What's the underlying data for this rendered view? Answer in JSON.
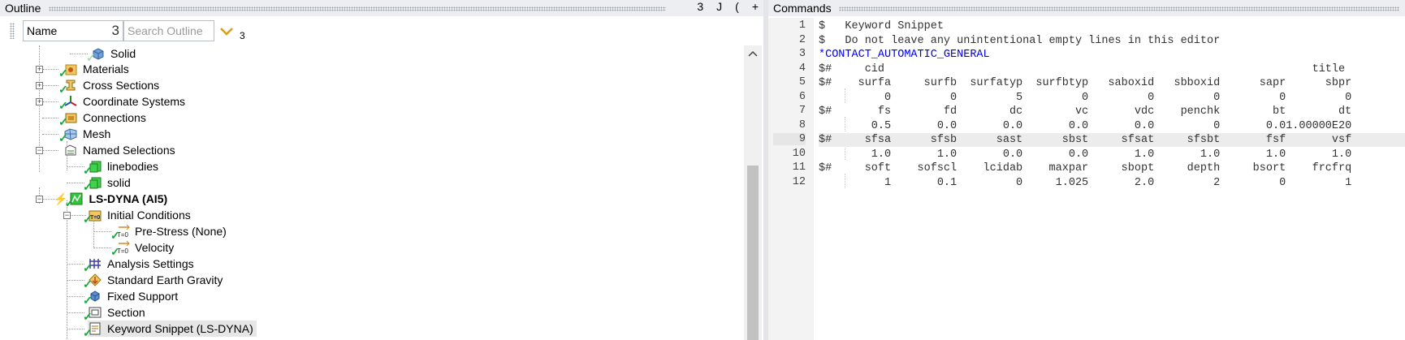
{
  "outline": {
    "title": "Outline",
    "actions": [
      "3",
      "J",
      "(",
      "+"
    ],
    "name_field": {
      "value": "Name",
      "count": "3"
    },
    "search": {
      "placeholder": "Search Outline"
    },
    "filter_count": "3",
    "tree": [
      {
        "label": "Solid",
        "icon": "solid-body-icon"
      },
      {
        "label": "Materials",
        "icon": "materials-icon"
      },
      {
        "label": "Cross Sections",
        "icon": "cross-sections-icon"
      },
      {
        "label": "Coordinate Systems",
        "icon": "coordinate-systems-icon"
      },
      {
        "label": "Connections",
        "icon": "connections-icon"
      },
      {
        "label": "Mesh",
        "icon": "mesh-icon"
      },
      {
        "label": "Named Selections",
        "icon": "named-selections-icon"
      },
      {
        "label": "linebodies",
        "icon": "named-selection-item-icon"
      },
      {
        "label": "solid",
        "icon": "named-selection-item-icon"
      },
      {
        "label": "LS-DYNA (AI5)",
        "icon": "ls-dyna-icon"
      },
      {
        "label": "Initial Conditions",
        "icon": "initial-conditions-icon"
      },
      {
        "label": "Pre-Stress (None)",
        "icon": "pre-stress-icon"
      },
      {
        "label": "Velocity",
        "icon": "velocity-icon"
      },
      {
        "label": "Analysis Settings",
        "icon": "analysis-settings-icon"
      },
      {
        "label": "Standard Earth Gravity",
        "icon": "gravity-icon"
      },
      {
        "label": "Fixed Support",
        "icon": "fixed-support-icon"
      },
      {
        "label": "Section",
        "icon": "section-icon"
      },
      {
        "label": "Keyword Snippet (LS-DYNA)",
        "icon": "keyword-snippet-icon"
      }
    ]
  },
  "commands": {
    "title": "Commands",
    "lines": [
      {
        "n": "1",
        "text": "$   Keyword Snippet"
      },
      {
        "n": "2",
        "text": "$   Do not leave any unintentional empty lines in this editor"
      },
      {
        "n": "3",
        "text": "*CONTACT_AUTOMATIC_GENERAL"
      },
      {
        "n": "4",
        "text": "$#     cid                                                                 title"
      },
      {
        "n": "5",
        "text": "$#    surfa     surfb  surfatyp  surfbtyp   saboxid   sbboxid      sapr      sbpr"
      },
      {
        "n": "6",
        "text": "          0         0         5         0         0         0         0         0"
      },
      {
        "n": "7",
        "text": "$#       fs        fd        dc        vc       vdc    penchk        bt        dt"
      },
      {
        "n": "8",
        "text": "        0.5       0.0       0.0       0.0       0.0         0       0.01.00000E20"
      },
      {
        "n": "9",
        "text": "$#     sfsa      sfsb      sast      sbst     sfsat     sfsbt       fsf       vsf"
      },
      {
        "n": "10",
        "text": "        1.0       1.0       0.0       0.0       1.0       1.0       1.0       1.0"
      },
      {
        "n": "11",
        "text": "$#     soft    sofscl    lcidab    maxpar     sbopt     depth     bsort    frcfrq"
      },
      {
        "n": "12",
        "text": "          1       0.1         0     1.025       2.0         2         0         1"
      }
    ]
  },
  "colors": {
    "accent": "#0000ee",
    "check": "#1aa83c",
    "selected": "#e6e6e6"
  }
}
